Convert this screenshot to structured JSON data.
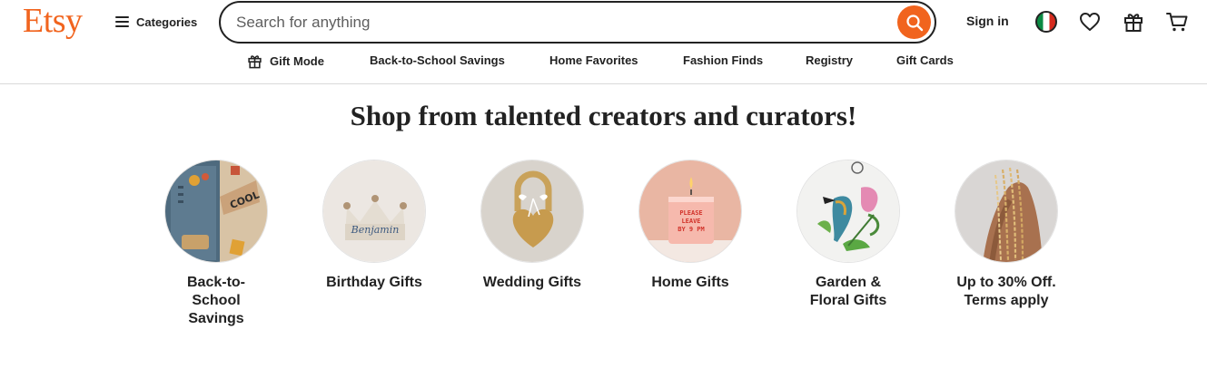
{
  "header": {
    "logo": "Etsy",
    "categories_label": "Categories",
    "search_placeholder": "Search for anything",
    "signin_label": "Sign in",
    "icons": [
      "search-icon",
      "italy-flag-icon",
      "heart-icon",
      "gift-icon",
      "cart-icon"
    ]
  },
  "nav": {
    "items": [
      {
        "label": "Gift Mode",
        "icon": "gift-icon"
      },
      {
        "label": "Back-to-School Savings"
      },
      {
        "label": "Home Favorites"
      },
      {
        "label": "Fashion Finds"
      },
      {
        "label": "Registry"
      },
      {
        "label": "Gift Cards"
      }
    ]
  },
  "main": {
    "headline": "Shop from talented creators and curators!",
    "tiles": [
      {
        "label": "Back-to-School Savings",
        "image_text": "COOL"
      },
      {
        "label": "Birthday Gifts",
        "image_text": "Benjamin"
      },
      {
        "label": "Wedding Gifts",
        "image_text": ""
      },
      {
        "label": "Home Gifts",
        "image_text": "PLEASE LEAVE BY 9 PM"
      },
      {
        "label": "Garden & Floral Gifts",
        "image_text": ""
      },
      {
        "label": "Up to 30% Off. Terms apply",
        "image_text": ""
      }
    ]
  },
  "colors": {
    "brand": "#f1641e",
    "text": "#222222",
    "divider": "#d9d9d9"
  }
}
